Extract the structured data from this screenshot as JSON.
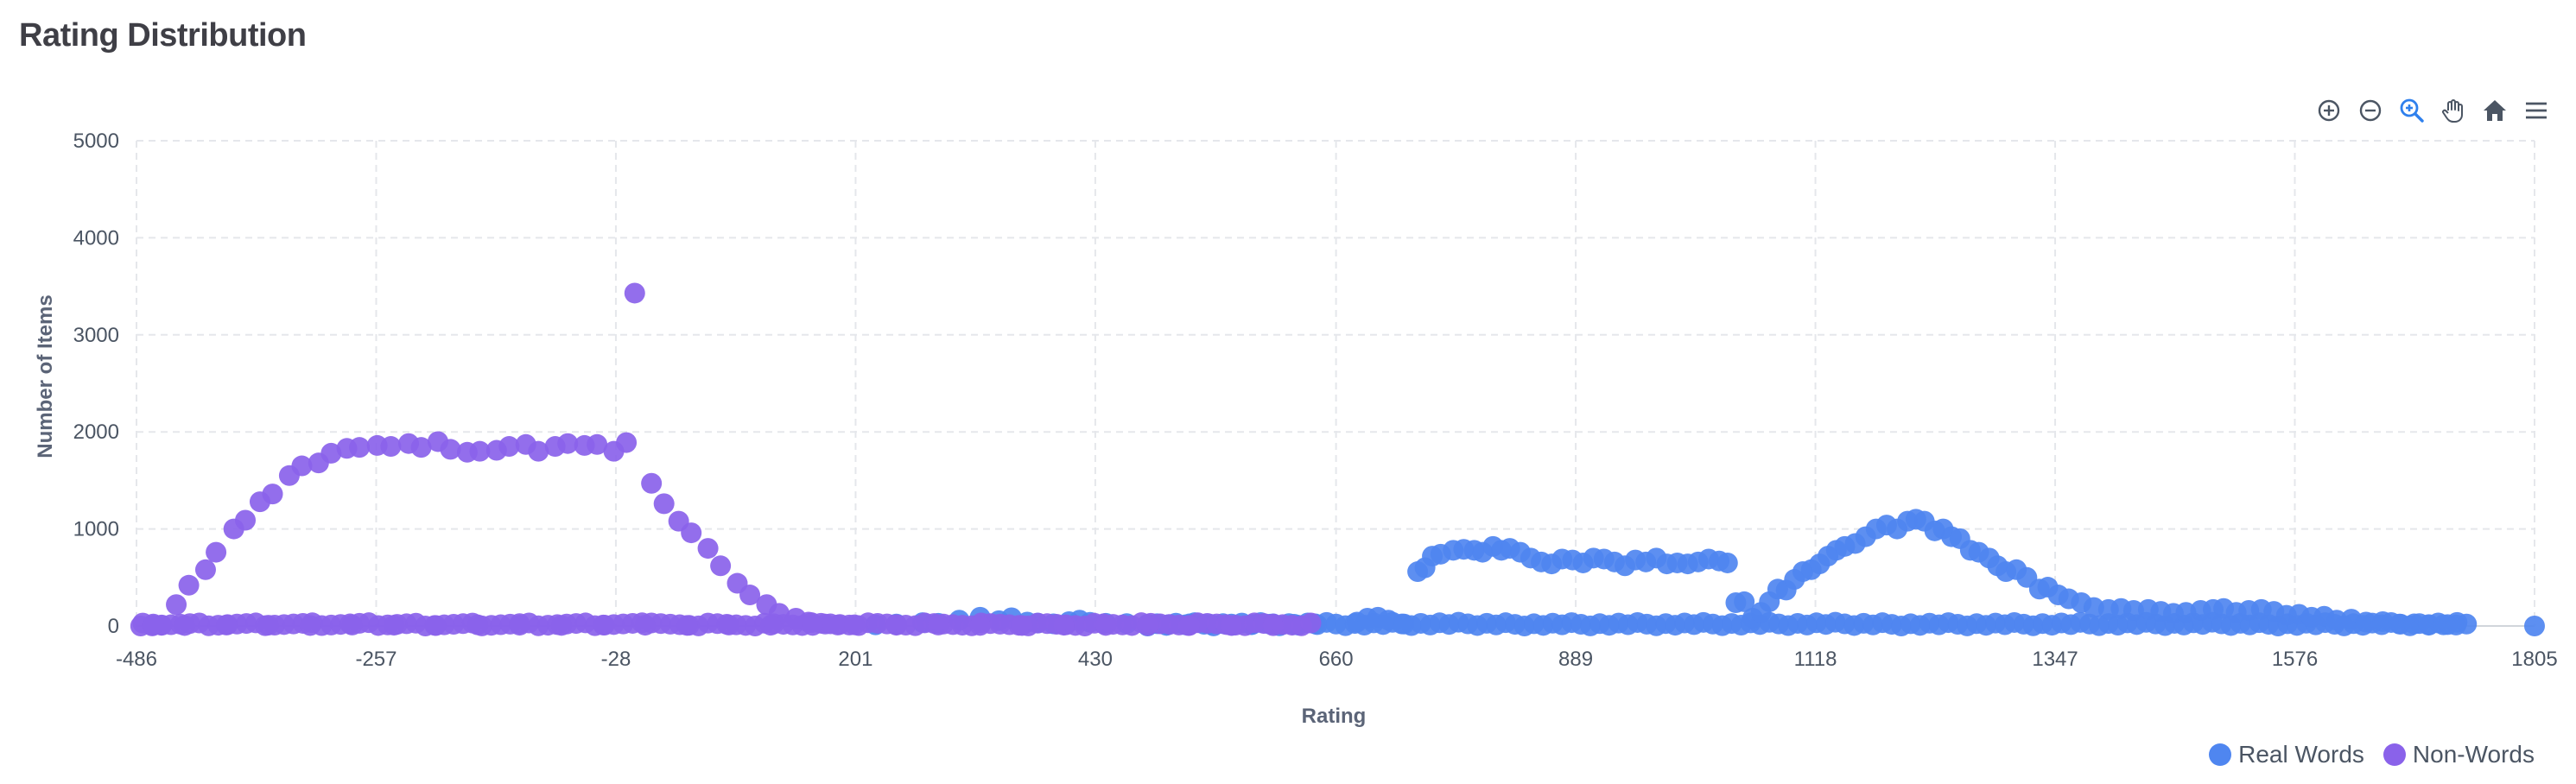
{
  "page": {
    "title": "Rating Distribution"
  },
  "toolbar": {
    "icons": [
      "zoom-in-icon",
      "zoom-out-icon",
      "selection-zoom-icon",
      "pan-hand-icon",
      "home-reset-icon",
      "menu-icon"
    ]
  },
  "colors": {
    "real": "#4f86f0",
    "non": "#8a62ea",
    "grid": "#e5e7eb",
    "axis": "#d1d5db"
  },
  "chart_data": {
    "type": "scatter",
    "title": "Rating Distribution",
    "xlabel": "Rating",
    "ylabel": "Number of Items",
    "xlim": [
      -486,
      1805
    ],
    "ylim": [
      0,
      5000
    ],
    "x_ticks": [
      "-486",
      "-257",
      "-28",
      "201",
      "430",
      "660",
      "889",
      "1118",
      "1347",
      "1576",
      "1805"
    ],
    "y_ticks": [
      "0",
      "1000",
      "2000",
      "3000",
      "4000",
      "5000"
    ],
    "grid": true,
    "legend": "bottom-right",
    "series": [
      {
        "name": "Real Words",
        "color": "#4f86f0",
        "points": [
          [
            220,
            12
          ],
          [
            240,
            20
          ],
          [
            265,
            35
          ],
          [
            280,
            28
          ],
          [
            300,
            60
          ],
          [
            320,
            90
          ],
          [
            338,
            55
          ],
          [
            350,
            85
          ],
          [
            365,
            40
          ],
          [
            375,
            30
          ],
          [
            390,
            22
          ],
          [
            405,
            45
          ],
          [
            415,
            60
          ],
          [
            425,
            38
          ],
          [
            440,
            28
          ],
          [
            460,
            25
          ],
          [
            480,
            18
          ],
          [
            500,
            15
          ],
          [
            520,
            22
          ],
          [
            540,
            18
          ],
          [
            560,
            20
          ],
          [
            580,
            16
          ],
          [
            600,
            22
          ],
          [
            620,
            18
          ],
          [
            640,
            22
          ],
          [
            680,
            40
          ],
          [
            690,
            80
          ],
          [
            700,
            90
          ],
          [
            710,
            60
          ],
          [
            725,
            20
          ],
          [
            738,
            560
          ],
          [
            745,
            600
          ],
          [
            752,
            720
          ],
          [
            760,
            740
          ],
          [
            772,
            780
          ],
          [
            782,
            790
          ],
          [
            792,
            780
          ],
          [
            800,
            760
          ],
          [
            810,
            820
          ],
          [
            818,
            780
          ],
          [
            826,
            800
          ],
          [
            836,
            760
          ],
          [
            846,
            700
          ],
          [
            856,
            660
          ],
          [
            866,
            640
          ],
          [
            876,
            690
          ],
          [
            886,
            680
          ],
          [
            896,
            650
          ],
          [
            906,
            700
          ],
          [
            916,
            690
          ],
          [
            926,
            660
          ],
          [
            936,
            620
          ],
          [
            946,
            680
          ],
          [
            956,
            660
          ],
          [
            966,
            700
          ],
          [
            976,
            640
          ],
          [
            986,
            650
          ],
          [
            996,
            640
          ],
          [
            1006,
            660
          ],
          [
            1016,
            690
          ],
          [
            1026,
            670
          ],
          [
            1034,
            650
          ],
          [
            1042,
            240
          ],
          [
            1050,
            250
          ],
          [
            1058,
            80
          ],
          [
            1066,
            140
          ],
          [
            1074,
            250
          ],
          [
            1082,
            380
          ],
          [
            1090,
            370
          ],
          [
            1098,
            480
          ],
          [
            1106,
            560
          ],
          [
            1114,
            580
          ],
          [
            1122,
            640
          ],
          [
            1130,
            720
          ],
          [
            1138,
            780
          ],
          [
            1146,
            820
          ],
          [
            1156,
            850
          ],
          [
            1166,
            920
          ],
          [
            1176,
            1000
          ],
          [
            1186,
            1040
          ],
          [
            1196,
            1000
          ],
          [
            1206,
            1080
          ],
          [
            1214,
            1100
          ],
          [
            1222,
            1080
          ],
          [
            1232,
            980
          ],
          [
            1240,
            1000
          ],
          [
            1248,
            920
          ],
          [
            1256,
            900
          ],
          [
            1266,
            780
          ],
          [
            1274,
            760
          ],
          [
            1284,
            700
          ],
          [
            1292,
            620
          ],
          [
            1300,
            560
          ],
          [
            1310,
            580
          ],
          [
            1320,
            500
          ],
          [
            1332,
            380
          ],
          [
            1340,
            400
          ],
          [
            1350,
            320
          ],
          [
            1360,
            280
          ],
          [
            1372,
            240
          ],
          [
            1384,
            190
          ],
          [
            1398,
            170
          ],
          [
            1410,
            180
          ],
          [
            1422,
            160
          ],
          [
            1436,
            170
          ],
          [
            1448,
            150
          ],
          [
            1460,
            130
          ],
          [
            1472,
            140
          ],
          [
            1486,
            160
          ],
          [
            1498,
            170
          ],
          [
            1508,
            180
          ],
          [
            1520,
            140
          ],
          [
            1532,
            160
          ],
          [
            1544,
            170
          ],
          [
            1556,
            150
          ],
          [
            1568,
            110
          ],
          [
            1580,
            120
          ],
          [
            1592,
            90
          ],
          [
            1604,
            100
          ],
          [
            1616,
            60
          ],
          [
            1630,
            70
          ],
          [
            1644,
            40
          ],
          [
            1660,
            45
          ],
          [
            1676,
            20
          ],
          [
            1690,
            22
          ],
          [
            1704,
            15
          ],
          [
            1718,
            12
          ],
          [
            1730,
            10
          ],
          [
            1805,
            0
          ]
        ]
      },
      {
        "name": "Non-Words",
        "color": "#8a62ea",
        "points": [
          [
            -482,
            0
          ],
          [
            -470,
            20
          ],
          [
            -462,
            10
          ],
          [
            -448,
            220
          ],
          [
            -436,
            420
          ],
          [
            -420,
            580
          ],
          [
            -410,
            760
          ],
          [
            -393,
            1000
          ],
          [
            -382,
            1090
          ],
          [
            -368,
            1280
          ],
          [
            -356,
            1360
          ],
          [
            -340,
            1550
          ],
          [
            -328,
            1650
          ],
          [
            -312,
            1680
          ],
          [
            -300,
            1780
          ],
          [
            -285,
            1830
          ],
          [
            -273,
            1840
          ],
          [
            -256,
            1860
          ],
          [
            -243,
            1850
          ],
          [
            -226,
            1880
          ],
          [
            -214,
            1840
          ],
          [
            -198,
            1900
          ],
          [
            -186,
            1820
          ],
          [
            -170,
            1790
          ],
          [
            -158,
            1800
          ],
          [
            -142,
            1810
          ],
          [
            -130,
            1850
          ],
          [
            -114,
            1870
          ],
          [
            -102,
            1800
          ],
          [
            -86,
            1850
          ],
          [
            -74,
            1880
          ],
          [
            -58,
            1860
          ],
          [
            -46,
            1870
          ],
          [
            -30,
            1800
          ],
          [
            -18,
            1890
          ],
          [
            -10,
            3430
          ],
          [
            6,
            1470
          ],
          [
            18,
            1260
          ],
          [
            32,
            1080
          ],
          [
            44,
            960
          ],
          [
            60,
            800
          ],
          [
            72,
            620
          ],
          [
            88,
            440
          ],
          [
            100,
            320
          ],
          [
            116,
            220
          ],
          [
            128,
            130
          ],
          [
            144,
            80
          ],
          [
            156,
            40
          ],
          [
            172,
            20
          ],
          [
            184,
            10
          ],
          [
            -470,
            8
          ],
          [
            -440,
            5
          ],
          [
            -400,
            10
          ],
          [
            -360,
            8
          ],
          [
            -320,
            5
          ],
          [
            -280,
            10
          ],
          [
            -240,
            8
          ],
          [
            -200,
            5
          ],
          [
            -160,
            12
          ],
          [
            -120,
            8
          ],
          [
            -80,
            6
          ],
          [
            -40,
            10
          ],
          [
            0,
            8
          ],
          [
            40,
            6
          ],
          [
            80,
            10
          ],
          [
            120,
            8
          ],
          [
            160,
            6
          ],
          [
            200,
            12
          ],
          [
            240,
            8
          ],
          [
            280,
            10
          ],
          [
            320,
            6
          ],
          [
            360,
            5
          ],
          [
            400,
            8
          ],
          [
            440,
            6
          ],
          [
            480,
            4
          ],
          [
            520,
            6
          ],
          [
            560,
            5
          ],
          [
            600,
            3
          ]
        ]
      }
    ]
  },
  "legend": {
    "real_label": "Real Words",
    "non_label": "Non-Words"
  }
}
